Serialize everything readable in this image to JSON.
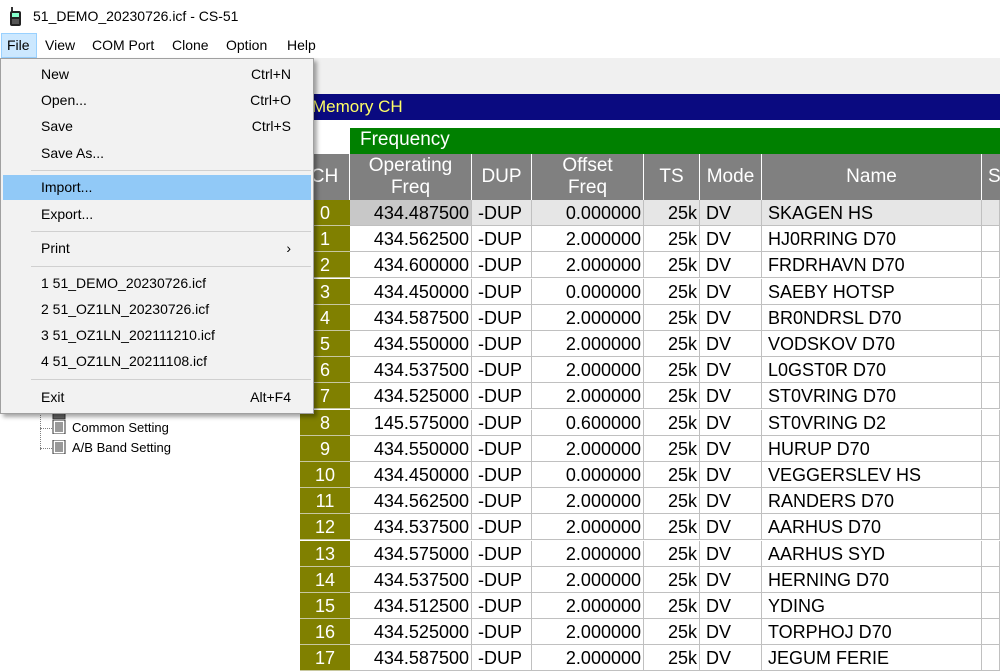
{
  "window": {
    "title": "51_DEMO_20230726.icf - CS-51"
  },
  "menubar": {
    "items": [
      "File",
      "View",
      "COM Port",
      "Clone",
      "Option",
      "Help"
    ]
  },
  "file_menu": {
    "new": {
      "label": "New",
      "shortcut": "Ctrl+N"
    },
    "open": {
      "label": "Open...",
      "shortcut": "Ctrl+O"
    },
    "save": {
      "label": "Save",
      "shortcut": "Ctrl+S"
    },
    "save_as": {
      "label": "Save As..."
    },
    "import": {
      "label": "Import..."
    },
    "export": {
      "label": "Export..."
    },
    "print": {
      "label": "Print",
      "arrow": "›"
    },
    "recent": [
      "1 51_DEMO_20230726.icf",
      "2 51_OZ1LN_20230726.icf",
      "3 51_OZ1LN_202111210.icf",
      "4 51_OZ1LN_20211108.icf"
    ],
    "exit": {
      "label": "Exit",
      "shortcut": "Alt+F4"
    }
  },
  "tree": {
    "items": [
      "Common Setting",
      "A/B Band Setting"
    ]
  },
  "memory": {
    "header": "Memory CH",
    "group_header": "Frequency",
    "columns": {
      "ch": "CH",
      "op_freq_1": "Operating",
      "op_freq_2": "Freq",
      "dup": "DUP",
      "offset_1": "Offset",
      "offset_2": "Freq",
      "ts": "TS",
      "mode": "Mode",
      "name": "Name",
      "extra": "S"
    },
    "rows": [
      {
        "ch": "0",
        "freq": "434.487500",
        "dup": "-DUP",
        "offset": "0.000000",
        "ts": "25k",
        "mode": "DV",
        "name": "SKAGEN HS"
      },
      {
        "ch": "1",
        "freq": "434.562500",
        "dup": "-DUP",
        "offset": "2.000000",
        "ts": "25k",
        "mode": "DV",
        "name": "HJ0RRING D70"
      },
      {
        "ch": "2",
        "freq": "434.600000",
        "dup": "-DUP",
        "offset": "2.000000",
        "ts": "25k",
        "mode": "DV",
        "name": "FRDRHAVN D70"
      },
      {
        "ch": "3",
        "freq": "434.450000",
        "dup": "-DUP",
        "offset": "0.000000",
        "ts": "25k",
        "mode": "DV",
        "name": "SAEBY HOTSP"
      },
      {
        "ch": "4",
        "freq": "434.587500",
        "dup": "-DUP",
        "offset": "2.000000",
        "ts": "25k",
        "mode": "DV",
        "name": "BR0NDRSL D70"
      },
      {
        "ch": "5",
        "freq": "434.550000",
        "dup": "-DUP",
        "offset": "2.000000",
        "ts": "25k",
        "mode": "DV",
        "name": "VODSKOV D70"
      },
      {
        "ch": "6",
        "freq": "434.537500",
        "dup": "-DUP",
        "offset": "2.000000",
        "ts": "25k",
        "mode": "DV",
        "name": "L0GST0R D70"
      },
      {
        "ch": "7",
        "freq": "434.525000",
        "dup": "-DUP",
        "offset": "2.000000",
        "ts": "25k",
        "mode": "DV",
        "name": "ST0VRING D70"
      },
      {
        "ch": "8",
        "freq": "145.575000",
        "dup": "-DUP",
        "offset": "0.600000",
        "ts": "25k",
        "mode": "DV",
        "name": "ST0VRING D2"
      },
      {
        "ch": "9",
        "freq": "434.550000",
        "dup": "-DUP",
        "offset": "2.000000",
        "ts": "25k",
        "mode": "DV",
        "name": "HURUP D70"
      },
      {
        "ch": "10",
        "freq": "434.450000",
        "dup": "-DUP",
        "offset": "0.000000",
        "ts": "25k",
        "mode": "DV",
        "name": "VEGGERSLEV HS"
      },
      {
        "ch": "11",
        "freq": "434.562500",
        "dup": "-DUP",
        "offset": "2.000000",
        "ts": "25k",
        "mode": "DV",
        "name": "RANDERS D70"
      },
      {
        "ch": "12",
        "freq": "434.537500",
        "dup": "-DUP",
        "offset": "2.000000",
        "ts": "25k",
        "mode": "DV",
        "name": "AARHUS D70"
      },
      {
        "ch": "13",
        "freq": "434.575000",
        "dup": "-DUP",
        "offset": "2.000000",
        "ts": "25k",
        "mode": "DV",
        "name": "AARHUS SYD"
      },
      {
        "ch": "14",
        "freq": "434.537500",
        "dup": "-DUP",
        "offset": "2.000000",
        "ts": "25k",
        "mode": "DV",
        "name": "HERNING D70"
      },
      {
        "ch": "15",
        "freq": "434.512500",
        "dup": "-DUP",
        "offset": "2.000000",
        "ts": "25k",
        "mode": "DV",
        "name": "YDING"
      },
      {
        "ch": "16",
        "freq": "434.525000",
        "dup": "-DUP",
        "offset": "2.000000",
        "ts": "25k",
        "mode": "DV",
        "name": "TORPHOJ D70"
      },
      {
        "ch": "17",
        "freq": "434.587500",
        "dup": "-DUP",
        "offset": "2.000000",
        "ts": "25k",
        "mode": "DV",
        "name": "JEGUM FERIE"
      }
    ]
  },
  "colors": {
    "memory_header_bg": "#0a0a80",
    "memory_header_text": "#ffff66",
    "frequency_bar": "#008000",
    "ch_cell": "#808000",
    "column_header": "#808080",
    "menu_highlight": "#91c9f7"
  }
}
